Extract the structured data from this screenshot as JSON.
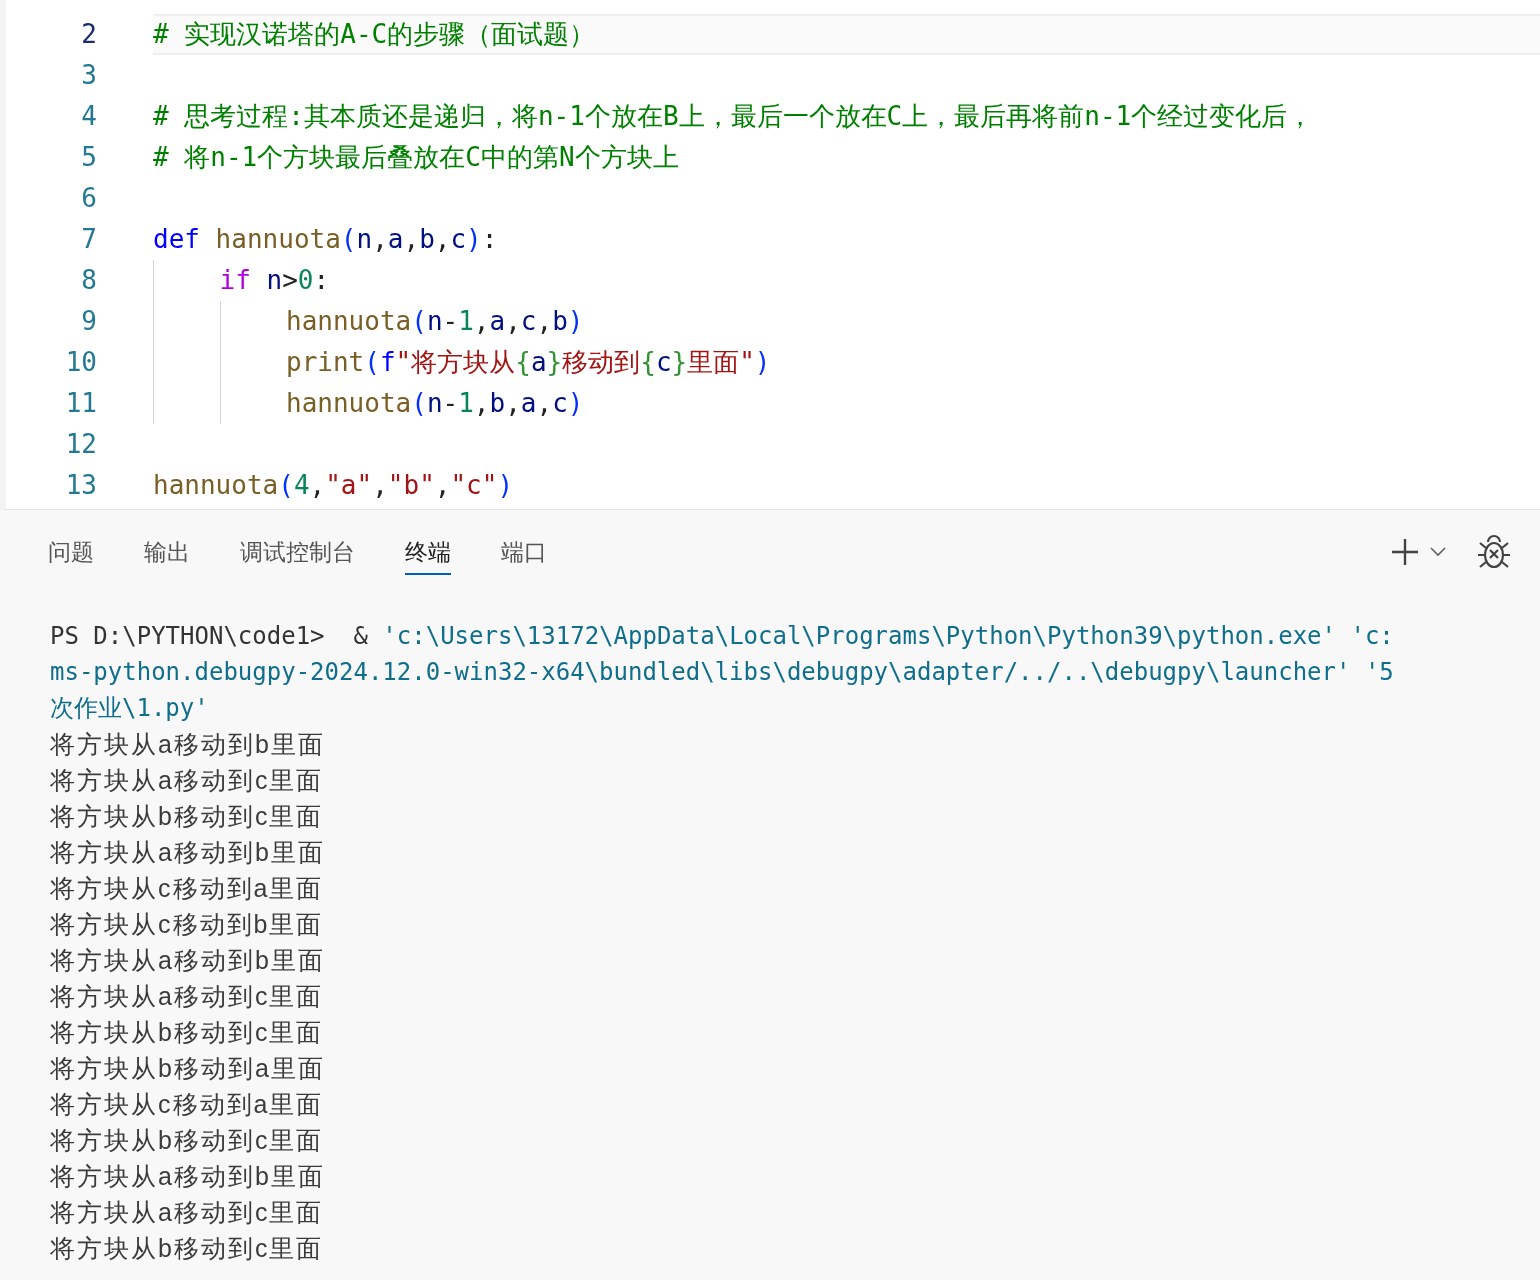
{
  "editor": {
    "lines": [
      {
        "number": "2",
        "current": true,
        "tokens": [
          {
            "kind": "comment",
            "text": "# 实现汉诺塔的A-C的步骤（面试题）"
          }
        ]
      },
      {
        "number": "3",
        "current": false
      },
      {
        "number": "4",
        "current": false,
        "tokens": [
          {
            "kind": "comment",
            "text": "# 思考过程:其本质还是递归，将n-1个放在B上，最后一个放在C上，最后再将前n-1个经过变化后，"
          }
        ]
      },
      {
        "number": "5",
        "current": false,
        "tokens": [
          {
            "kind": "comment",
            "text": "# 将n-1个方块最后叠放在C中的第N个方块上"
          }
        ]
      },
      {
        "number": "6",
        "current": false
      },
      {
        "number": "7",
        "current": false,
        "tokens": [
          {
            "kind": "storage",
            "text": "def"
          },
          {
            "kind": "func",
            "text": " hannuota"
          },
          {
            "kind": "paren",
            "text": "("
          },
          {
            "kind": "var",
            "text": "n"
          },
          {
            "kind": "plain",
            "text": ","
          },
          {
            "kind": "var",
            "text": "a"
          },
          {
            "kind": "plain",
            "text": ","
          },
          {
            "kind": "var",
            "text": "b"
          },
          {
            "kind": "plain",
            "text": ","
          },
          {
            "kind": "var",
            "text": "c"
          },
          {
            "kind": "paren",
            "text": ")"
          },
          {
            "kind": "plain",
            "text": ":"
          }
        ],
        "children": [
          {
            "number": "8",
            "current": false,
            "tokens": [
              {
                "kind": "keyword",
                "text": "if"
              },
              {
                "kind": "var",
                "text": " n"
              },
              {
                "kind": "plain",
                "text": ">"
              },
              {
                "kind": "num",
                "text": "0"
              },
              {
                "kind": "plain",
                "text": ":"
              }
            ],
            "children": [
              {
                "number": "9",
                "current": false,
                "tokens": [
                  {
                    "kind": "func",
                    "text": "hannuota"
                  },
                  {
                    "kind": "paren",
                    "text": "("
                  },
                  {
                    "kind": "var",
                    "text": "n"
                  },
                  {
                    "kind": "plain",
                    "text": "-"
                  },
                  {
                    "kind": "num",
                    "text": "1"
                  },
                  {
                    "kind": "plain",
                    "text": ","
                  },
                  {
                    "kind": "var",
                    "text": "a"
                  },
                  {
                    "kind": "plain",
                    "text": ","
                  },
                  {
                    "kind": "var",
                    "text": "c"
                  },
                  {
                    "kind": "plain",
                    "text": ","
                  },
                  {
                    "kind": "var",
                    "text": "b"
                  },
                  {
                    "kind": "paren",
                    "text": ")"
                  }
                ]
              },
              {
                "number": "10",
                "current": false,
                "tokens": [
                  {
                    "kind": "func",
                    "text": "print"
                  },
                  {
                    "kind": "paren",
                    "text": "("
                  },
                  {
                    "kind": "storage",
                    "text": "f"
                  },
                  {
                    "kind": "str",
                    "text": "\"将方块从"
                  },
                  {
                    "kind": "brace",
                    "text": "{"
                  },
                  {
                    "kind": "var",
                    "text": "a"
                  },
                  {
                    "kind": "brace",
                    "text": "}"
                  },
                  {
                    "kind": "str",
                    "text": "移动到"
                  },
                  {
                    "kind": "brace",
                    "text": "{"
                  },
                  {
                    "kind": "var",
                    "text": "c"
                  },
                  {
                    "kind": "brace",
                    "text": "}"
                  },
                  {
                    "kind": "str",
                    "text": "里面\""
                  },
                  {
                    "kind": "paren",
                    "text": ")"
                  }
                ]
              },
              {
                "number": "11",
                "current": false,
                "tokens": [
                  {
                    "kind": "func",
                    "text": "hannuota"
                  },
                  {
                    "kind": "paren",
                    "text": "("
                  },
                  {
                    "kind": "var",
                    "text": "n"
                  },
                  {
                    "kind": "plain",
                    "text": "-"
                  },
                  {
                    "kind": "num",
                    "text": "1"
                  },
                  {
                    "kind": "plain",
                    "text": ","
                  },
                  {
                    "kind": "var",
                    "text": "b"
                  },
                  {
                    "kind": "plain",
                    "text": ","
                  },
                  {
                    "kind": "var",
                    "text": "a"
                  },
                  {
                    "kind": "plain",
                    "text": ","
                  },
                  {
                    "kind": "var",
                    "text": "c"
                  },
                  {
                    "kind": "paren",
                    "text": ")"
                  }
                ]
              }
            ]
          }
        ]
      },
      {
        "number": "12",
        "current": false
      },
      {
        "number": "13",
        "current": false,
        "tokens": [
          {
            "kind": "func",
            "text": "hannuota"
          },
          {
            "kind": "paren",
            "text": "("
          },
          {
            "kind": "num",
            "text": "4"
          },
          {
            "kind": "plain",
            "text": ","
          },
          {
            "kind": "str",
            "text": "\"a\""
          },
          {
            "kind": "plain",
            "text": ","
          },
          {
            "kind": "str",
            "text": "\"b\""
          },
          {
            "kind": "plain",
            "text": ","
          },
          {
            "kind": "str",
            "text": "\"c\""
          },
          {
            "kind": "paren",
            "text": ")"
          }
        ]
      }
    ]
  },
  "panel": {
    "tabs": [
      {
        "label": "问题",
        "selected": false
      },
      {
        "label": "输出",
        "selected": false
      },
      {
        "label": "调试控制台",
        "selected": false
      },
      {
        "label": "终端",
        "selected": true
      },
      {
        "label": "端口",
        "selected": false
      }
    ],
    "terminal": {
      "command_lines": [
        [
          {
            "kind": "prompt",
            "text": "PS D:\\PYTHON\\code1>  & "
          },
          {
            "kind": "path",
            "text": "'c:\\Users\\13172\\AppData\\Local\\Programs\\Python\\Python39\\python.exe' 'c:"
          }
        ],
        [
          {
            "kind": "path",
            "text": "ms-python.debugpy-2024.12.0-win32-x64\\bundled\\libs\\debugpy\\adapter/../..\\debugpy\\launcher' '5"
          }
        ],
        [
          {
            "kind": "path",
            "text": "次作业\\1.py'"
          }
        ]
      ],
      "output": [
        "将方块从a移动到b里面",
        "将方块从a移动到c里面",
        "将方块从b移动到c里面",
        "将方块从a移动到b里面",
        "将方块从c移动到a里面",
        "将方块从c移动到b里面",
        "将方块从a移动到b里面",
        "将方块从a移动到c里面",
        "将方块从b移动到c里面",
        "将方块从b移动到a里面",
        "将方块从c移动到a里面",
        "将方块从b移动到c里面",
        "将方块从a移动到b里面",
        "将方块从a移动到c里面",
        "将方块从b移动到c里面"
      ]
    }
  }
}
